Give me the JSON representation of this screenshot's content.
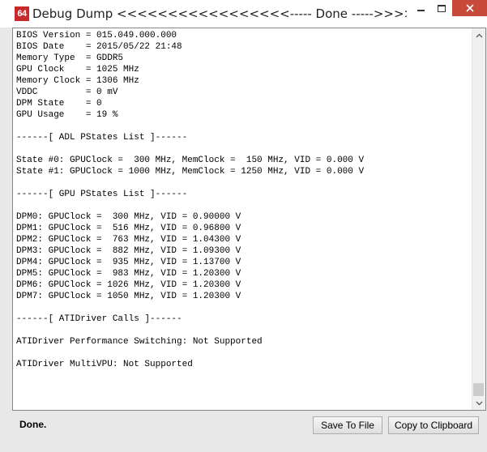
{
  "window": {
    "icon_text": "64",
    "title": "Debug Dump  <<<<<<<<<<<<<<<<<----- Done ----->>>>>>>>>>>>>>>>>>"
  },
  "log_lines": [
    "BIOS Version = 015.049.000.000",
    "BIOS Date    = 2015/05/22 21:48",
    "Memory Type  = GDDR5",
    "GPU Clock    = 1025 MHz",
    "Memory Clock = 1306 MHz",
    "VDDC         = 0 mV",
    "DPM State    = 0",
    "GPU Usage    = 19 %",
    "",
    "------[ ADL PStates List ]------",
    "",
    "State #0: GPUClock =  300 MHz, MemClock =  150 MHz, VID = 0.000 V",
    "State #1: GPUClock = 1000 MHz, MemClock = 1250 MHz, VID = 0.000 V",
    "",
    "------[ GPU PStates List ]------",
    "",
    "DPM0: GPUClock =  300 MHz, VID = 0.90000 V",
    "DPM1: GPUClock =  516 MHz, VID = 0.96800 V",
    "DPM2: GPUClock =  763 MHz, VID = 1.04300 V",
    "DPM3: GPUClock =  882 MHz, VID = 1.09300 V",
    "DPM4: GPUClock =  935 MHz, VID = 1.13700 V",
    "DPM5: GPUClock =  983 MHz, VID = 1.20300 V",
    "DPM6: GPUClock = 1026 MHz, VID = 1.20300 V",
    "DPM7: GPUClock = 1050 MHz, VID = 1.20300 V",
    "",
    "------[ ATIDriver Calls ]------",
    "",
    "ATIDriver Performance Switching: Not Supported",
    "",
    "ATIDriver MultiVPU: Not Supported"
  ],
  "status": {
    "text": "Done."
  },
  "buttons": {
    "save_label": "Save To File",
    "clipboard_label": "Copy to Clipboard"
  },
  "scroll": {
    "position": 1.0
  },
  "colors": {
    "close_button": "#c7493a",
    "app_icon": "#c62a2a"
  },
  "icons": {
    "app": "app-64-icon",
    "minimize": "minimize-icon",
    "maximize": "maximize-icon",
    "close": "close-icon",
    "scroll_up": "chevron-up-icon",
    "scroll_down": "chevron-down-icon"
  }
}
